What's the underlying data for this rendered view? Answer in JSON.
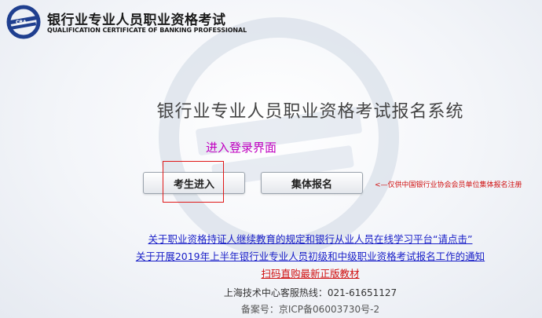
{
  "header": {
    "brand_cn": "银行业专业人员职业资格考试",
    "brand_en": "QUALIFICATION CERTIFICATE OF BANKING PROFESSIONAL"
  },
  "main": {
    "title": "银行业专业人员职业资格考试报名系统",
    "annotation_login": "进入登录界面",
    "candidate_button": "考生进入",
    "group_button": "集体报名",
    "group_note": "<—仅供中国银行业协会会员单位集体报名注册"
  },
  "links": {
    "continuing_education": "关于职业资格持证人继续教育的规定和银行从业人员在线学习平台“请点击”",
    "exam_notice": "关于开展2019年上半年银行业专业人员初级和中级职业资格考试报名工作的通知",
    "buy_materials": "扫码直购最新正版教材"
  },
  "footer": {
    "hotline": "上海技术中心客服热线：021-61651127",
    "icp": "备案号：京ICP备06003730号-2"
  },
  "colors": {
    "link_blue": "#1a20c8",
    "link_red": "#d01010",
    "annotation_magenta": "#c000c0",
    "logo_blue": "#1f3f8f"
  }
}
